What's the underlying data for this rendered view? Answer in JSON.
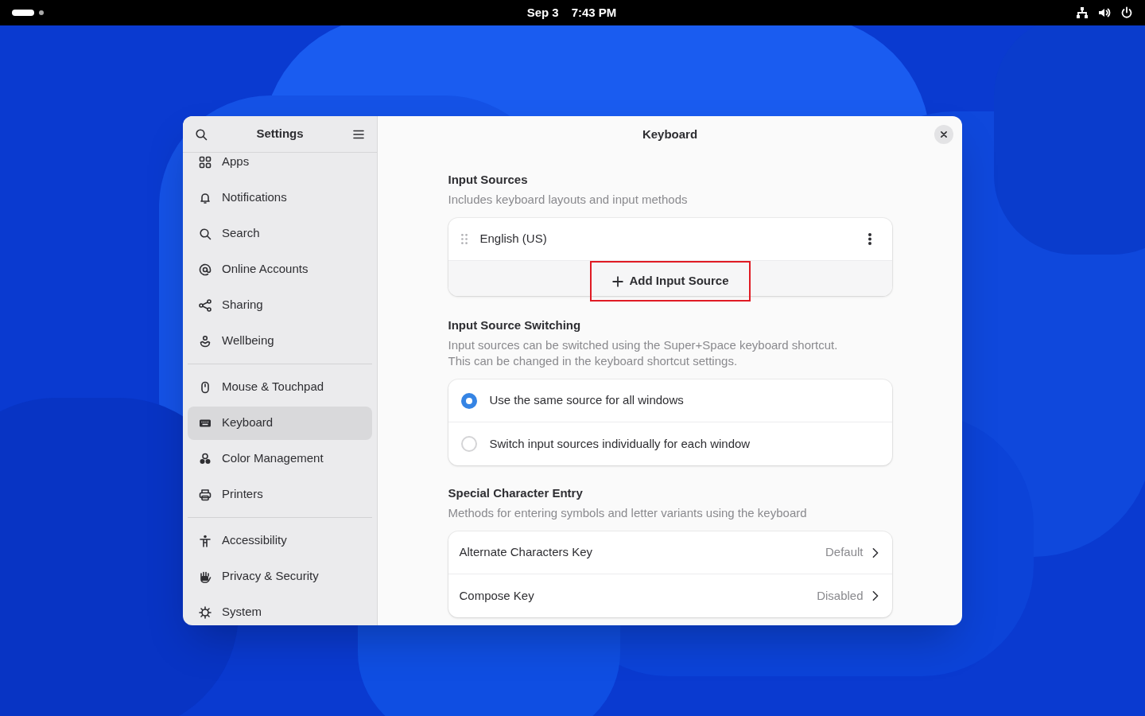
{
  "top_bar": {
    "date": "Sep 3",
    "time": "7:43 PM"
  },
  "sidebar": {
    "title": "Settings",
    "groups": [
      {
        "items": [
          {
            "label": "Apps",
            "selected": false
          },
          {
            "label": "Notifications",
            "selected": false
          },
          {
            "label": "Search",
            "selected": false
          },
          {
            "label": "Online Accounts",
            "selected": false
          },
          {
            "label": "Sharing",
            "selected": false
          },
          {
            "label": "Wellbeing",
            "selected": false
          }
        ]
      },
      {
        "items": [
          {
            "label": "Mouse & Touchpad",
            "selected": false
          },
          {
            "label": "Keyboard",
            "selected": true
          },
          {
            "label": "Color Management",
            "selected": false
          },
          {
            "label": "Printers",
            "selected": false
          }
        ]
      },
      {
        "items": [
          {
            "label": "Accessibility",
            "selected": false
          },
          {
            "label": "Privacy & Security",
            "selected": false
          },
          {
            "label": "System",
            "selected": false
          }
        ]
      }
    ]
  },
  "page": {
    "title": "Keyboard",
    "input_sources": {
      "heading": "Input Sources",
      "description": "Includes keyboard layouts and input methods",
      "sources": [
        "English (US)"
      ],
      "add_button": {
        "label": "Add Input Source",
        "highlighted": true
      }
    },
    "switching": {
      "heading": "Input Source Switching",
      "description": [
        "Input sources can be switched using the Super+Space keyboard shortcut.",
        "This can be changed in the keyboard shortcut settings."
      ],
      "options": [
        {
          "label": "Use the same source for all windows",
          "selected": true
        },
        {
          "label": "Switch input sources individually for each window",
          "selected": false
        }
      ]
    },
    "special": {
      "heading": "Special Character Entry",
      "description": "Methods for entering symbols and letter variants using the keyboard",
      "rows": [
        {
          "label": "Alternate Characters Key",
          "value": "Default"
        },
        {
          "label": "Compose Key",
          "value": "Disabled"
        }
      ]
    }
  }
}
